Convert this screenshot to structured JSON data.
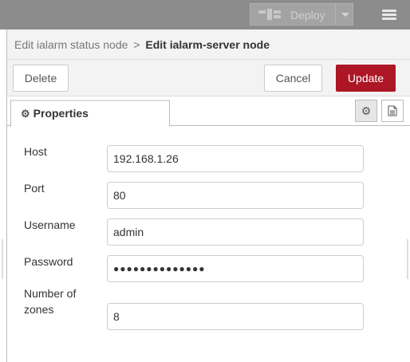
{
  "header": {
    "deploy_label": "Deploy",
    "deploy_icon": "deploy-icon",
    "menu_icon": "hamburger-menu-icon"
  },
  "tray": {
    "breadcrumb": {
      "parent": "Edit ialarm status node",
      "separator": ">",
      "current": "Edit ialarm-server node"
    },
    "toolbar": {
      "delete_label": "Delete",
      "cancel_label": "Cancel",
      "update_label": "Update",
      "update_color": "#ad1625"
    },
    "tabs": {
      "properties_label": "Properties",
      "properties_icon": "gear-icon",
      "settings_icon": "gear-icon",
      "description_icon": "document-icon"
    },
    "form": {
      "host": {
        "label": "Host",
        "value": "192.168.1.26"
      },
      "port": {
        "label": "Port",
        "value": "80"
      },
      "username": {
        "label": "Username",
        "value": "admin"
      },
      "password": {
        "label": "Password",
        "value": "●●●●●●●●●●●●●●"
      },
      "zones": {
        "label_line1": "Number of",
        "label_line2": "zones",
        "value": "8"
      }
    }
  }
}
